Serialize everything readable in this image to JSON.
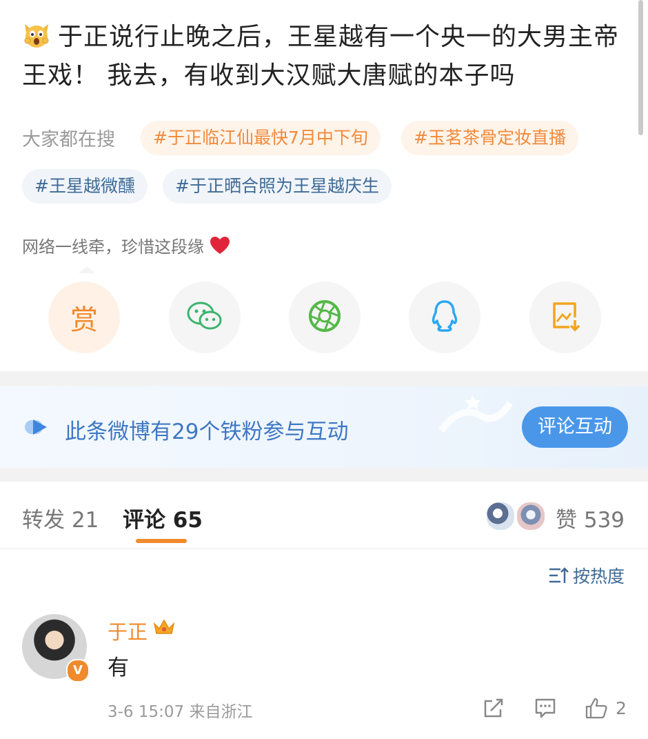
{
  "post": {
    "emoji": "scream-cat-emoji",
    "text": "于正说行止晚之后，王星越有一个央一的大男主帝王戏！ 我去，有收到大汉赋大唐赋的本子吗"
  },
  "search": {
    "label": "大家都在搜",
    "tags": [
      {
        "text": "#于正临江仙最快7月中下旬"
      },
      {
        "text": "#玉茗茶骨定妆直播"
      },
      {
        "text": "#王星越微醺"
      },
      {
        "text": "#于正晒合照为王星越庆生"
      }
    ]
  },
  "reward_slogan": "网络一线牵，珍惜这段缘",
  "share": {
    "reward_label": "赏",
    "items": [
      "wechat-icon",
      "moments-icon",
      "qq-icon",
      "save-image-icon"
    ]
  },
  "fans_banner": {
    "text": "此条微博有29个铁粉参与互动",
    "button": "评论互动"
  },
  "tabs": {
    "repost": "转发 21",
    "comments": "评论 65",
    "likes": "赞 539"
  },
  "sort_label": "按热度",
  "comment": {
    "author": "于正",
    "text": "有",
    "meta": "3-6 15:07 来自浙江",
    "likes": "2"
  },
  "colors": {
    "accent_orange": "#f08a2c",
    "link_blue": "#3e6a96",
    "button_blue": "#4a97ea"
  }
}
